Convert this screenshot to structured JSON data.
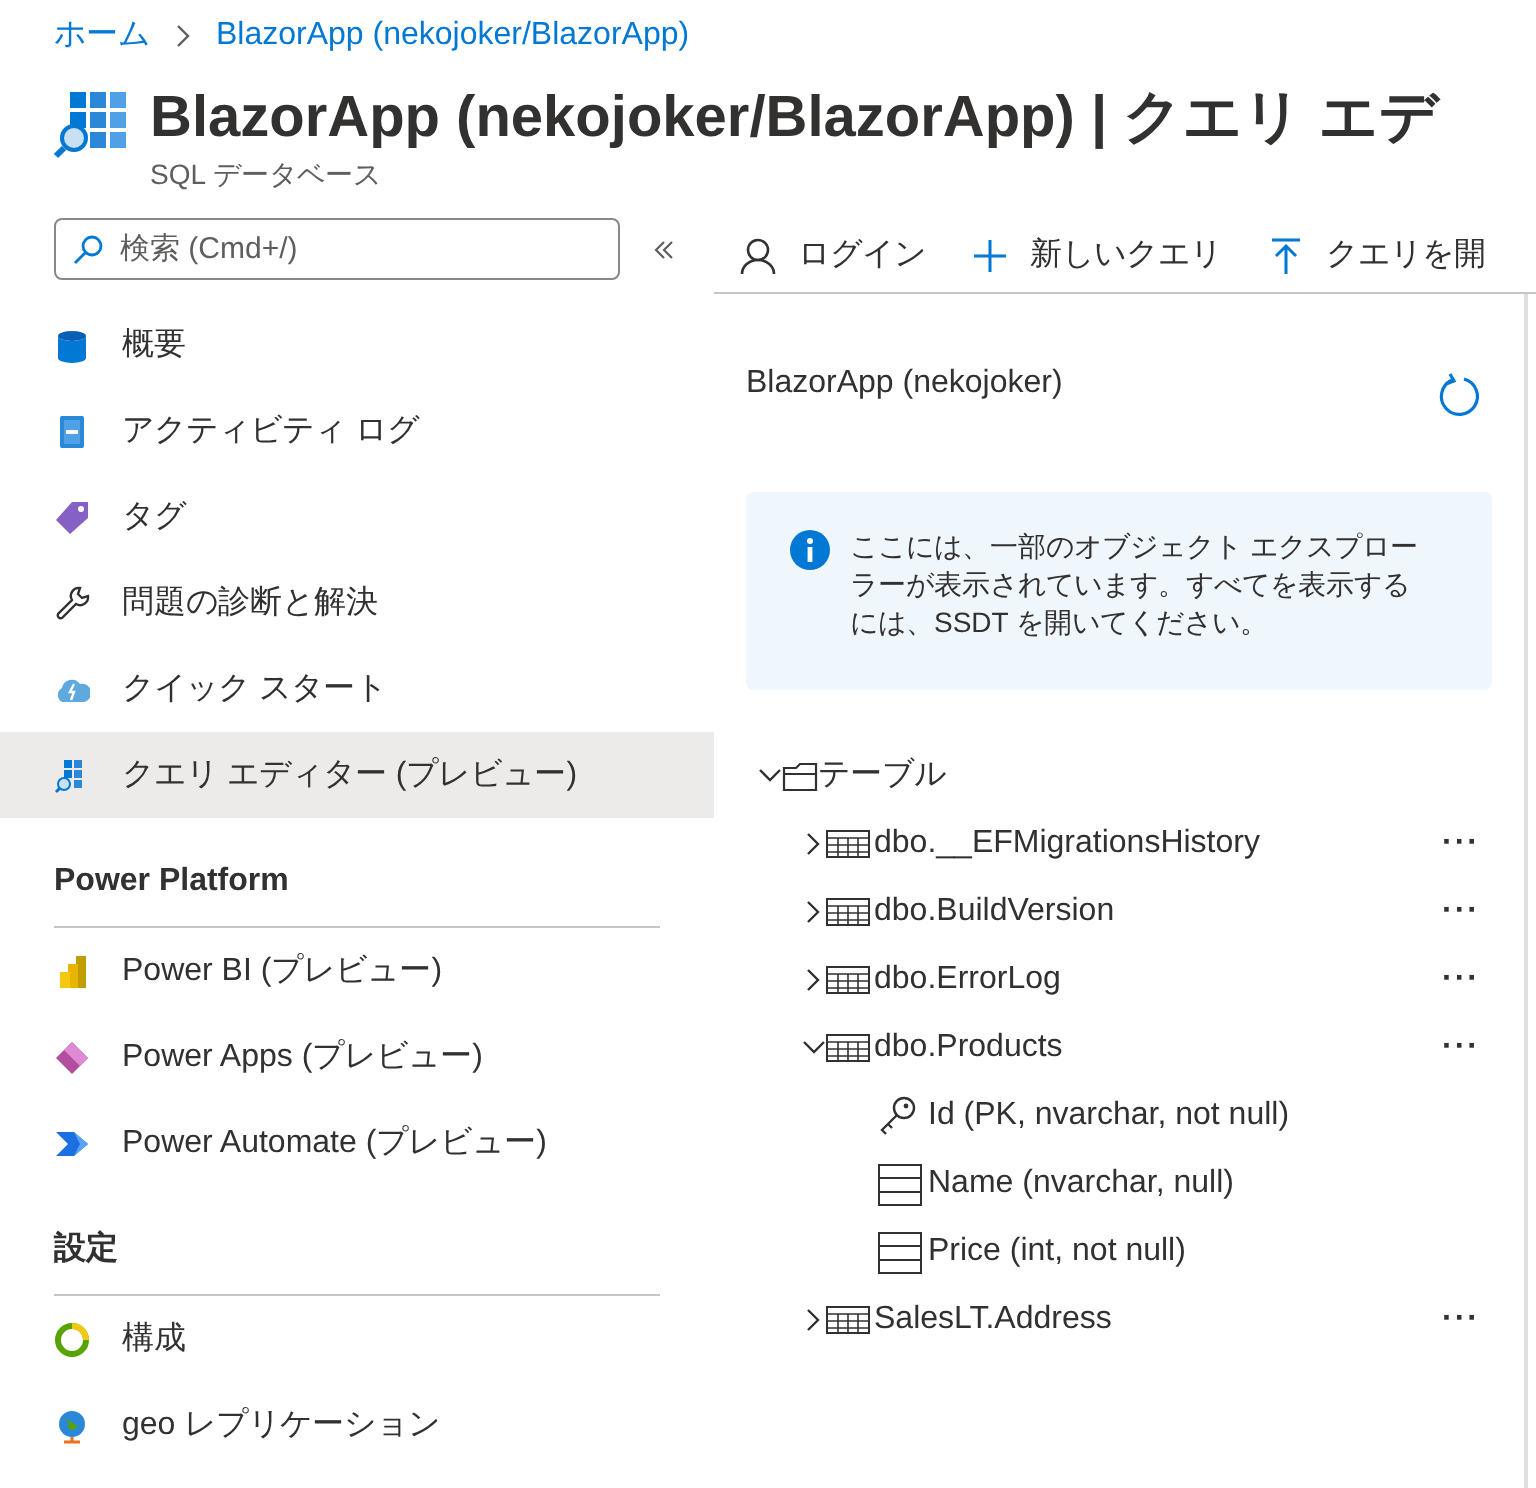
{
  "breadcrumb": [
    {
      "label": "ホーム"
    },
    {
      "label": "BlazorApp (nekojoker/BlazorApp)"
    }
  ],
  "header": {
    "title": "BlazorApp (nekojoker/BlazorApp) | クエリ エデ",
    "subtitle": "SQL データベース"
  },
  "sidebar": {
    "search": {
      "placeholder": "検索 (Cmd+/)"
    },
    "items": [
      {
        "label": "概要",
        "selected": false
      },
      {
        "label": "アクティビティ ログ",
        "selected": false
      },
      {
        "label": "タグ",
        "selected": false
      },
      {
        "label": "問題の診断と解決",
        "selected": false
      },
      {
        "label": "クイック スタート",
        "selected": false
      },
      {
        "label": "クエリ エディター (プレビュー)",
        "selected": true
      }
    ],
    "sections": [
      {
        "title": "Power Platform",
        "items": [
          {
            "label": "Power BI (プレビュー)",
            "selected": false
          },
          {
            "label": "Power Apps (プレビュー)",
            "selected": false
          },
          {
            "label": "Power Automate (プレビュー)",
            "selected": false
          }
        ]
      },
      {
        "title": "設定",
        "items": [
          {
            "label": "構成",
            "selected": false
          },
          {
            "label": "geo レプリケーション",
            "selected": false
          }
        ]
      }
    ]
  },
  "toolbar": [
    {
      "label": "ログイン"
    },
    {
      "label": "新しいクエリ"
    },
    {
      "label": "クエリを開"
    }
  ],
  "explorer": {
    "title": "BlazorApp (nekojoker)",
    "info": "ここには、一部のオブジェクト エクスプローラーが表示されています。すべてを表示するには、SSDT を開いてください。",
    "tree": {
      "label": "テーブル",
      "expanded": true,
      "children": [
        {
          "label": "dbo.__EFMigrationsHistory",
          "expanded": false,
          "more": "···"
        },
        {
          "label": "dbo.BuildVersion",
          "expanded": false,
          "more": "···"
        },
        {
          "label": "dbo.ErrorLog",
          "expanded": false,
          "more": "···"
        },
        {
          "label": "dbo.Products",
          "expanded": true,
          "more": "···",
          "children": [
            {
              "label": "Id (PK, nvarchar, not null)",
              "primary_key": true
            },
            {
              "label": "Name (nvarchar, null)",
              "primary_key": false
            },
            {
              "label": "Price (int, not null)",
              "primary_key": false
            }
          ]
        },
        {
          "label": "SalesLT.Address",
          "expanded": false,
          "more": "···"
        }
      ]
    }
  }
}
